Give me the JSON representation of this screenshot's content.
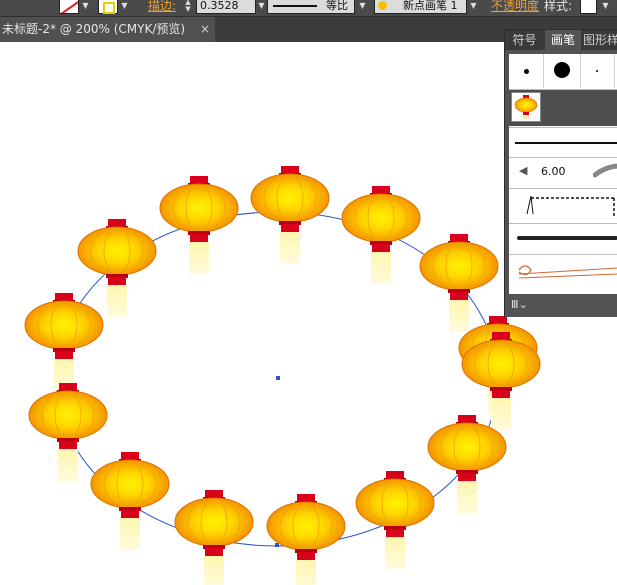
{
  "control_bar": {
    "stroke_label": "描边:",
    "stroke_weight": "0.3528",
    "profile_label": "等比",
    "brush_name": "新点画笔 1",
    "opacity_label": "不透明度",
    "style_label": "样式:"
  },
  "document_tab": {
    "title": "未标题-2* @ 200% (CMYK/预览)",
    "close": "×"
  },
  "panel": {
    "tabs": [
      "符号",
      "画笔",
      "图形样"
    ],
    "active_tab": "画笔",
    "brush_size": "6.00",
    "library_icon": "lib-menu-icon"
  },
  "icons": {
    "stroke_swatch": "no-stroke-swatch-icon",
    "fill_swatch": "fill-swatch-icon",
    "lantern": "lantern-icon"
  },
  "colors": {
    "ui_dark": "#4a4a4a",
    "panel": "#535353",
    "accent_label": "#e8a338",
    "lantern_red": "#d8001a",
    "lantern_yellow": "#fff200",
    "lantern_orange": "#f39800",
    "tassel": "#fffac8",
    "path_blue": "#2a56c8"
  },
  "canvas": {
    "lantern_count": 15
  }
}
